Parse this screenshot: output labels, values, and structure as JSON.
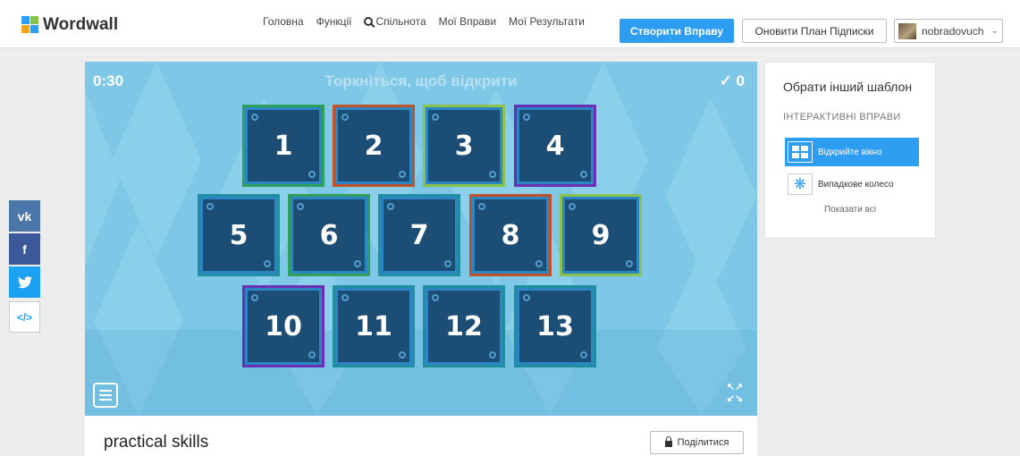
{
  "header": {
    "logo": "Wordwall",
    "nav": [
      "Головна",
      "Функції",
      "Спільнота",
      "Мої Вправи",
      "Мої Результати"
    ],
    "create_label": "Створити Вправу",
    "upgrade_label": "Оновити План Підписки",
    "username": "nobradovuch"
  },
  "game": {
    "timer": "0:30",
    "prompt": "Торкніться, щоб відкрити",
    "score": "✓ 0",
    "tiles": [
      {
        "label": "1",
        "frame": "#2ea05b"
      },
      {
        "label": "2",
        "frame": "#c0522a"
      },
      {
        "label": "3",
        "frame": "#8bc34a"
      },
      {
        "label": "4",
        "frame": "#6b2fb3"
      },
      {
        "label": "5",
        "frame": "#1f8fa0"
      },
      {
        "label": "6",
        "frame": "#2ea05b"
      },
      {
        "label": "7",
        "frame": "#1f8fa0"
      },
      {
        "label": "8",
        "frame": "#c0522a"
      },
      {
        "label": "9",
        "frame": "#8bc34a"
      },
      {
        "label": "10",
        "frame": "#6b2fb3"
      },
      {
        "label": "11",
        "frame": "#1f8fa0"
      },
      {
        "label": "12",
        "frame": "#1f8fa0"
      },
      {
        "label": "13",
        "frame": "#1f8fa0"
      }
    ]
  },
  "panel": {
    "title": "Обрати інший шаблон",
    "subtitle": "ІНТЕРАКТИВНІ ВПРАВИ",
    "templates": [
      "Відкрийте вікно",
      "Випадкове колесо"
    ],
    "show_all": "Показати всі"
  },
  "bottom": {
    "activity_title": "practical skills",
    "share_label": "Поділитися"
  },
  "colors": {
    "accent": "#2c9df0",
    "game_bg": "#7fc7e6",
    "tile_fill": "#1c4d75"
  }
}
